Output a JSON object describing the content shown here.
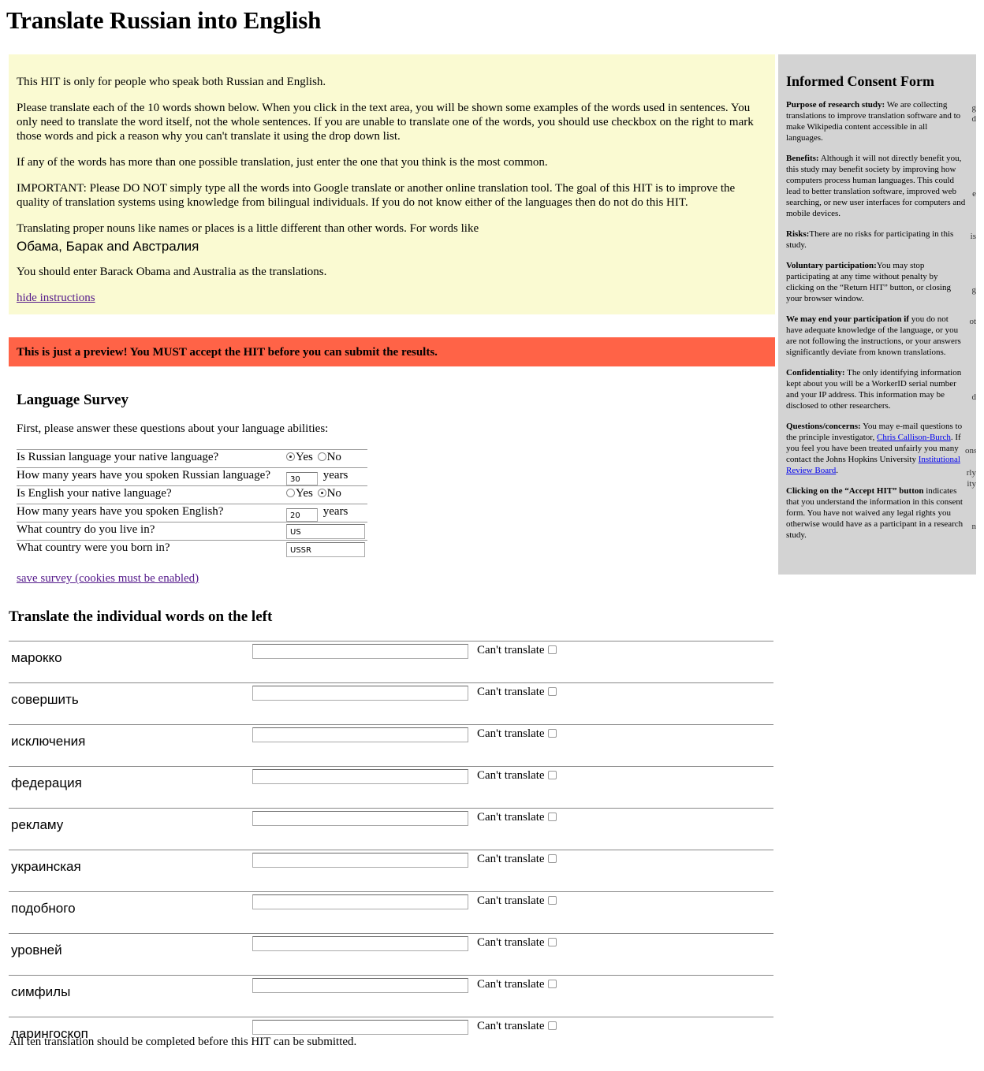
{
  "page": {
    "title": "Translate Russian into English"
  },
  "instructions": {
    "p1": "This HIT is only for people who speak both Russian and English.",
    "p2": "Please translate each of the 10 words shown below. When you click in the text area, you will be shown some examples of the words used in sentences. You only need to translate the word itself, not the whole sentences. If you are unable to translate one of the words, you should use checkbox on the right to mark those words and pick a reason why you can't translate it using the drop down list.",
    "p3": "If any of the words has more than one possible translation, just enter the one that you think is the most common.",
    "p4": "IMPORTANT: Please DO NOT simply type all the words into Google translate or another online translation tool. The goal of this HIT is to improve the quality of translation systems using knowledge from bilingual individuals. If you do not know either of the languages then do not do this HIT.",
    "p5": "Translating proper nouns like names or places is a little different than other words. For words like",
    "examples": "Обама, Барак and Австралия",
    "p6": "You should enter Barack Obama and Australia as the translations.",
    "hide_link": "hide instructions",
    "background_color": "#fafad2"
  },
  "preview_banner": {
    "text": "This is just a preview! You MUST accept the HIT before you can submit the results.",
    "color": "#ff6347"
  },
  "consent": {
    "title": "Informed Consent Form",
    "background_color": "#d3d3d3",
    "purpose_label": "Purpose of research study:",
    "purpose_text": " We are collecting translations to improve translation software and to make Wikipedia content accessible in all languages.",
    "benefits_label": "Benefits:",
    "benefits_text": " Although it will not directly benefit you, this study may benefit society by improving how computers process human languages. This could lead to better translation software, improved web searching, or new user interfaces for computers and mobile devices.",
    "risks_label": "Risks:",
    "risks_text": "There are no risks for participating in this study.",
    "voluntary_label": "Voluntary participation:",
    "voluntary_text": "You may stop participating at any time without penalty by clicking on the “Return HIT” button, or closing your browser window.",
    "end_label": "We may end your participation if",
    "end_text": " you do not have adequate knowledge of the language, or you are not following the instructions, or your answers significantly deviate from known translations.",
    "conf_label": "Confidentiality:",
    "conf_text": " The only identifying information kept about you will be a WorkerID serial number and your IP address. This information may be disclosed to other researchers.",
    "questions_label": "Questions/concerns:",
    "questions_text_1": " You may e-mail questions to the principle investigator, ",
    "investigator_link": "Chris Callison-Burch",
    "questions_text_2": ". If you feel you have been treated unfairly you many contact the Johns Hopkins University ",
    "irb_link": "Institutional Review Board",
    "questions_text_3": ".",
    "accept_label": "Clicking on the “Accept HIT” button",
    "accept_text": " indicates that you understand the information in this consent form. You have not waived any legal rights you otherwise would have as a participant in a research study.",
    "edge_fragments": [
      "g",
      "d",
      "e",
      "is",
      "g",
      "ot",
      "d",
      "ons",
      "rly",
      "ity",
      "n"
    ]
  },
  "survey": {
    "title": "Language Survey",
    "intro": "First, please answer these questions about your language abilities:",
    "yes_label": "Yes",
    "no_label": "No",
    "years_label": "years",
    "q1": "Is Russian language your native language?",
    "q1_answer": "yes",
    "q2": "How many years have you spoken Russian language?",
    "q2_value": "30",
    "q3": "Is English your native language?",
    "q3_answer": "no",
    "q4": "How many years have you spoken English?",
    "q4_value": "20",
    "q5": "What country do you live in?",
    "q5_value": "US",
    "q6": "What country were you born in?",
    "q6_value": "USSR",
    "save_link": "save survey (cookies must be enabled)"
  },
  "translate": {
    "heading": "Translate the individual words on the left",
    "cant_label": "Can't translate",
    "words": [
      "марокко",
      "совершить",
      "исключения",
      "федерация",
      "рекламу",
      "украинская",
      "подобного",
      "уровней",
      "симфилы",
      "ларингоскоп"
    ],
    "footer": "All ten translation should be completed before this HIT can be submitted."
  }
}
